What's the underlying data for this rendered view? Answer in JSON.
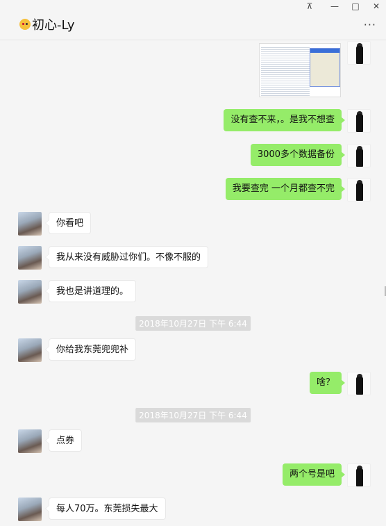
{
  "window": {
    "pin_glyph": "⊼",
    "minimize_glyph": "—",
    "maximize_glyph": "□",
    "close_glyph": "✕",
    "more_glyph": "···"
  },
  "contact": {
    "name": "初心-Ly",
    "emoji_icon": "kissing-face-icon"
  },
  "messages": [
    {
      "id": "m0",
      "sender": "me",
      "type": "image",
      "content": "spreadsheet-screenshot"
    },
    {
      "id": "m1",
      "sender": "me",
      "text": "没有查不来，。是我不想查"
    },
    {
      "id": "m2",
      "sender": "me",
      "text": "3000多个数据备份"
    },
    {
      "id": "m3",
      "sender": "me",
      "text": "我要查完 一个月都查不完"
    },
    {
      "id": "m4",
      "sender": "other",
      "text": "你看吧"
    },
    {
      "id": "m5",
      "sender": "other",
      "text": "我从来没有威胁过你们。不像不服的"
    },
    {
      "id": "m6",
      "sender": "other",
      "text": "我也是讲道理的。"
    },
    {
      "id": "t1",
      "type": "timestamp",
      "text": "2018年10月27日 下午 6:44"
    },
    {
      "id": "m7",
      "sender": "other",
      "text": "你给我东莞兜兜补"
    },
    {
      "id": "m8",
      "sender": "me",
      "text": "啥？"
    },
    {
      "id": "t2",
      "type": "timestamp",
      "text": "2018年10月27日 下午 6:44"
    },
    {
      "id": "m9",
      "sender": "other",
      "text": "点券"
    },
    {
      "id": "m10",
      "sender": "me",
      "text": "两个号是吧"
    },
    {
      "id": "m11",
      "sender": "other",
      "text": "每人70万。东莞损失最大"
    }
  ]
}
